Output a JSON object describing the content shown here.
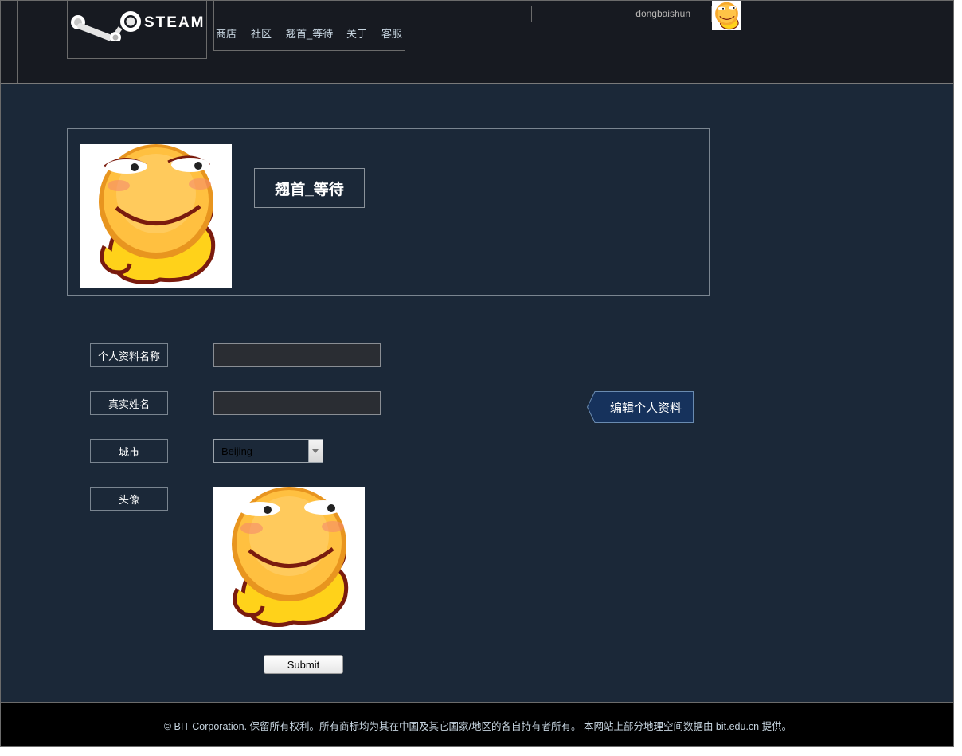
{
  "header": {
    "logo_text": "STEAM",
    "nav": [
      "商店",
      "社区",
      "翘首_等待",
      "关于",
      "客服"
    ],
    "username": "dongbaishun",
    "avatar_icon": "smiley-emoticon-icon"
  },
  "profile": {
    "display_name": "翘首_等待",
    "avatar_icon": "smiley-emoticon-icon"
  },
  "form": {
    "profile_name_label": "个人资料名称",
    "profile_name_value": "",
    "real_name_label": "真实姓名",
    "real_name_value": "",
    "city_label": "城市",
    "city_value": "Beijing",
    "avatar_label": "头像",
    "submit_label": "Submit"
  },
  "edit_profile_label": "编辑个人资料",
  "footer": {
    "text": "© BIT Corporation. 保留所有权利。所有商标均为其在中国及其它国家/地区的各自持有者所有。 本网站上部分地理空间数据由 bit.edu.cn 提供。"
  },
  "colors": {
    "page_bg": "#1b2838",
    "header_bg": "#171a21",
    "footer_bg": "#000000",
    "edit_tag_bg": "#16325c"
  }
}
